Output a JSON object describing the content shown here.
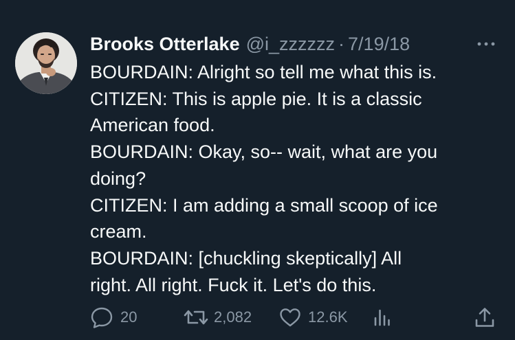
{
  "tweet": {
    "author_name": "Brooks Otterlake",
    "handle": "@i_zzzzzz",
    "separator": "·",
    "date": "7/19/18",
    "lines": [
      "BOURDAIN: Alright so tell me what this is.",
      "CITIZEN: This is apple pie. It is a classic",
      "American food.",
      "BOURDAIN: Okay, so-- wait, what are you",
      "doing?",
      "CITIZEN: I am adding a small scoop of ice",
      "cream.",
      "BOURDAIN: [chuckling skeptically] All",
      "right. All right. Fuck it. Let's do this."
    ]
  },
  "actions": {
    "replies": "20",
    "retweets": "2,082",
    "likes": "12.6K"
  },
  "icons": {
    "more": "more-horizontal-icon",
    "reply": "reply-icon",
    "retweet": "retweet-icon",
    "like": "heart-icon",
    "views": "analytics-icon",
    "share": "share-icon"
  },
  "colors": {
    "background": "#15202b",
    "primary_text": "#f7f9f9",
    "secondary_text": "#8b98a5"
  }
}
